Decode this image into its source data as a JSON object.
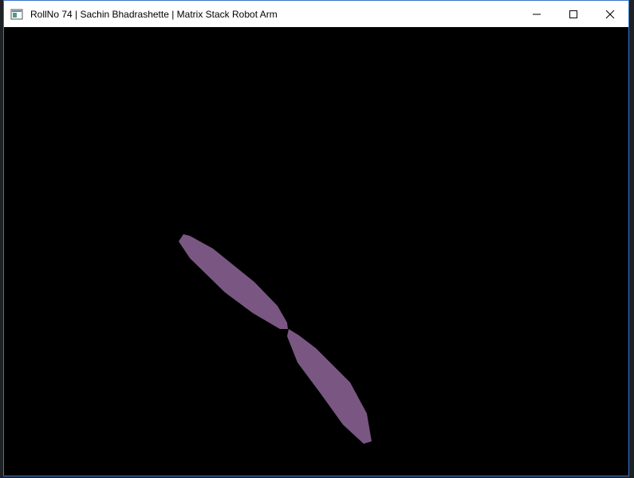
{
  "window": {
    "title": "RollNo 74 | Sachin Bhadrashette | Matrix Stack Robot Arm",
    "app_icon": "opengl-window-icon",
    "controls": [
      "minimize-icon",
      "maximize-icon",
      "close-icon"
    ]
  },
  "scene": {
    "background_color": "#000000",
    "arm_color": "#7a5782",
    "segments": [
      "upper-arm",
      "forearm"
    ]
  }
}
